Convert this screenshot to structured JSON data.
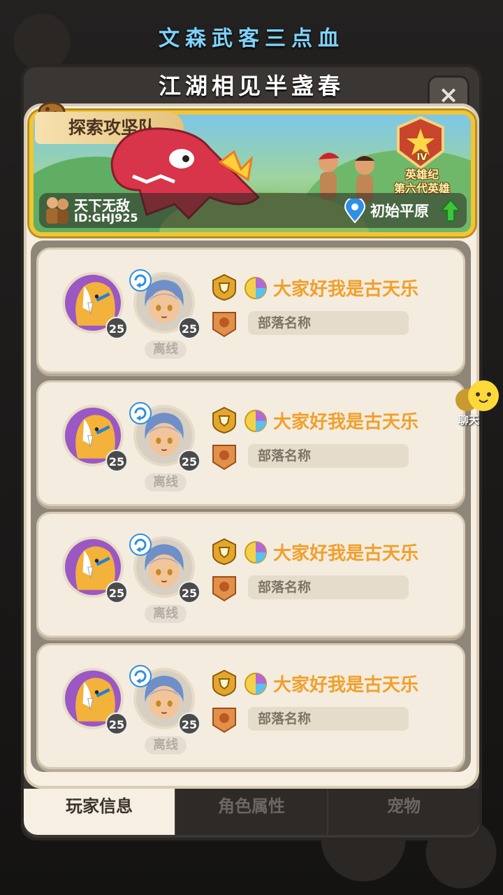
{
  "top_caption": "文森武客三点血",
  "panel": {
    "title": "江湖相见半盏春",
    "close_label": "×"
  },
  "banner": {
    "tag": "探索攻坚队",
    "team_name": "天下无敌",
    "team_id": "ID:GHJ925",
    "rank_roman": "IV",
    "rank_line1": "英雄纪",
    "rank_line2": "第六代英雄",
    "location": "初始平原"
  },
  "members": [
    {
      "pet_level": "25",
      "char_level": "25",
      "status": "离线",
      "name": "大家好我是古天乐",
      "tribe": "部落名称"
    },
    {
      "pet_level": "25",
      "char_level": "25",
      "status": "离线",
      "name": "大家好我是古天乐",
      "tribe": "部落名称"
    },
    {
      "pet_level": "25",
      "char_level": "25",
      "status": "离线",
      "name": "大家好我是古天乐",
      "tribe": "部落名称"
    },
    {
      "pet_level": "25",
      "char_level": "25",
      "status": "离线",
      "name": "大家好我是古天乐",
      "tribe": "部落名称"
    }
  ],
  "chat": {
    "label": "聊天"
  },
  "tabs": [
    {
      "label": "玩家信息",
      "active": true
    },
    {
      "label": "角色属性",
      "active": false
    },
    {
      "label": "宠物",
      "active": false
    }
  ],
  "colors": {
    "gold": "#f1c534",
    "name": "#f0a02c",
    "panel": "#f6efe2",
    "pet_bg": "#9b57c3"
  }
}
